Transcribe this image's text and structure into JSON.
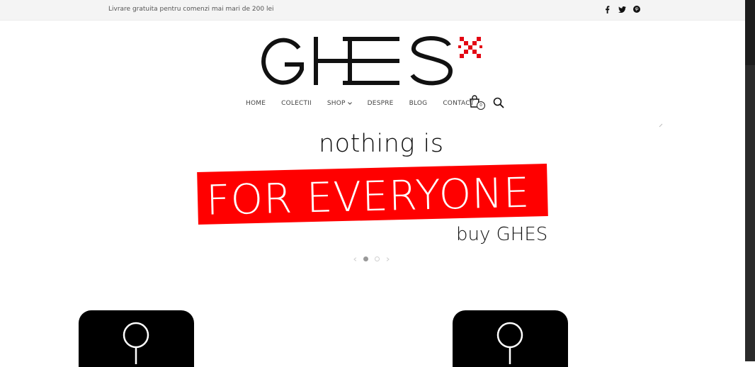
{
  "topbar": {
    "promo_text": "Livrare gratuita pentru comenzi mai mari de 200 lei",
    "social_icons": [
      "facebook-icon",
      "twitter-icon",
      "pinterest-icon"
    ]
  },
  "logo": {
    "text": "GHES",
    "accent_color": "#e30613"
  },
  "nav": {
    "items": [
      {
        "label": "HOME"
      },
      {
        "label": "COLECTII"
      },
      {
        "label": "SHOP"
      },
      {
        "label": "DESPRE"
      },
      {
        "label": "BLOG"
      },
      {
        "label": "CONTACT"
      }
    ],
    "cart_count": "0"
  },
  "hero": {
    "line1": "nothing is",
    "line2": "FOR EVERYONE",
    "line3": "buy GHES",
    "banner_color": "#ff0000"
  }
}
